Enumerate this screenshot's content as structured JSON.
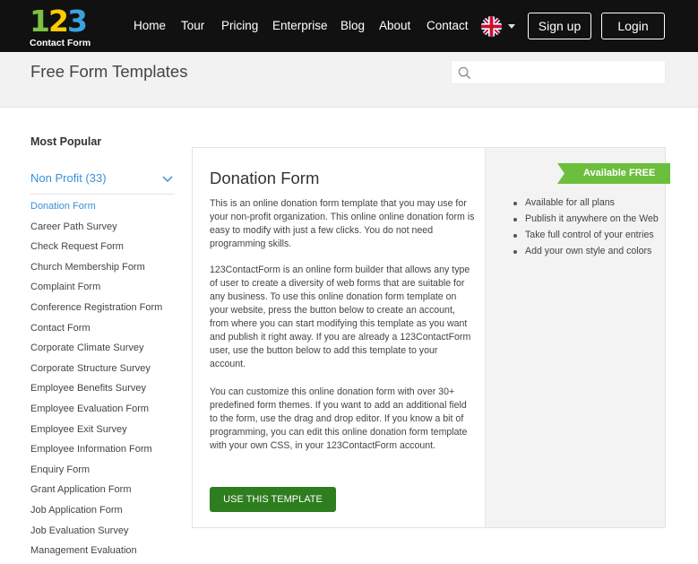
{
  "logo": {
    "digit1": "1",
    "digit2": "2",
    "digit3": "3",
    "text": "Contact Form"
  },
  "nav": {
    "home": "Home",
    "tour": "Tour",
    "pricing": "Pricing",
    "enterprise": "Enterprise",
    "blog": "Blog",
    "about": "About",
    "contact": "Contact",
    "language_icon": "uk-flag-icon",
    "signup": "Sign up",
    "login": "Login"
  },
  "header": {
    "title": "Free Form Templates",
    "search_placeholder": "",
    "search_icon": "search-icon"
  },
  "sidebar": {
    "heading": "Most Popular",
    "category": "Non Profit (33)",
    "items": [
      "Donation Form",
      "Career Path Survey",
      "Check Request Form",
      "Church Membership Form",
      "Complaint Form",
      "Conference Registration Form",
      "Contact Form",
      "Corporate Climate Survey",
      "Corporate Structure Survey",
      "Employee Benefits Survey",
      "Employee Evaluation Form",
      "Employee Exit Survey",
      "Employee Information Form",
      "Enquiry Form",
      "Grant Application Form",
      "Job Application Form",
      "Job Evaluation Survey",
      "Management Evaluation"
    ]
  },
  "template": {
    "title": "Donation Form",
    "para1": "This is an online donation form template that you may use for your non-profit organization. This online online donation form is easy to modify with just a few clicks. You do not need programming skills.",
    "para2": "123ContactForm is an online form builder that allows any type of user to create a diversity of web forms that are suitable for any business. To use this online donation form template on your website, press the button below to create an account, from where you can start modifying this template as you want and publish it right away. If you are already a 123ContactForm user, use the button below to add this template to your account.",
    "para3": "You can customize this online donation form with over 30+ predefined form themes. If you want to add an additional field to the form, use the drag and drop editor. If you know a bit of programming, you can edit this online donation form template with your own CSS, in your 123ContactForm account.",
    "button": "USE THIS TEMPLATE",
    "badge": "Available FREE",
    "features": [
      "Available for all plans",
      "Publish it anywhere on the Web",
      "Take full control of your entries",
      "Add your own style and colors"
    ]
  },
  "colors": {
    "topbar": "#111111",
    "accent_link": "#3a8fd6",
    "button_green": "#2e7d1f",
    "badge_green": "#6cbf3d"
  }
}
